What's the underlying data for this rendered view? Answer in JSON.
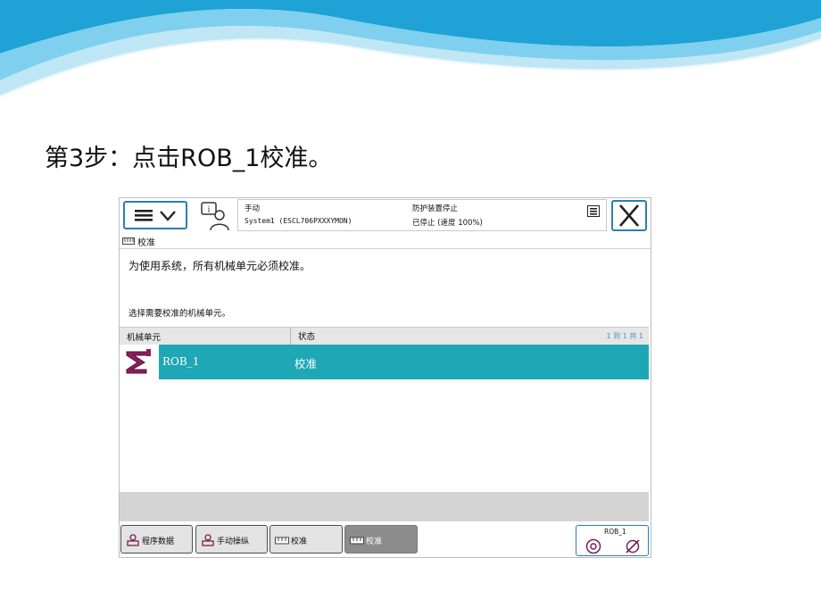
{
  "slide": {
    "step_title": "第3步：点击ROB_1校准。",
    "wave_colors": [
      "#1fa2d6",
      "#7fd0ee",
      "#bfe6f5"
    ]
  },
  "topbar": {
    "menu_icon": "hamburger-menu-icon",
    "quickset_icon": "operator-info-icon",
    "mode": "手动",
    "system": "System1 (ESCL706PXXXYMON)",
    "safety": "防护装置停止",
    "state": "已停止 (速度 100%)",
    "close_icon": "close-icon"
  },
  "breadcrumb": {
    "label": "校准"
  },
  "content": {
    "message": "为使用系统，所有机械单元必须校准。",
    "instruction": "选择需要校准的机械单元。"
  },
  "table": {
    "col_unit": "机械单元",
    "col_status": "状态",
    "count": "1 到 1 共 1",
    "rows": [
      {
        "unit": "ROB_1",
        "status": "校准",
        "selected": true
      }
    ]
  },
  "taskbar": {
    "tasks": [
      {
        "label": "程序数据",
        "icon": "program-data-icon",
        "active": false
      },
      {
        "label": "手动操纵",
        "icon": "jogging-icon",
        "active": false
      },
      {
        "label": "校准",
        "icon": "calibration-icon",
        "active": false
      },
      {
        "label": "校准",
        "icon": "calibration-icon",
        "active": true
      }
    ],
    "robot_label": "ROB_1"
  },
  "colors": {
    "selection": "#1ea7b4",
    "accent": "#2a7fb3"
  }
}
